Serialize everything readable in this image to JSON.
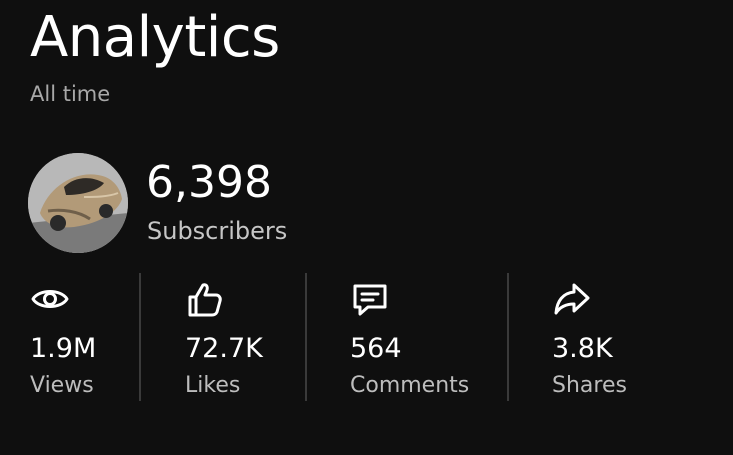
{
  "header": {
    "title": "Analytics",
    "period": "All time"
  },
  "channel": {
    "subscriber_count": "6,398",
    "subscriber_label": "Subscribers",
    "avatar_icon": "channel-avatar"
  },
  "stats": [
    {
      "icon": "eye-icon",
      "value": "1.9M",
      "label": "Views"
    },
    {
      "icon": "thumbs-up-icon",
      "value": "72.7K",
      "label": "Likes"
    },
    {
      "icon": "comment-icon",
      "value": "564",
      "label": "Comments"
    },
    {
      "icon": "share-icon",
      "value": "3.8K",
      "label": "Shares"
    }
  ],
  "colors": {
    "background": "#0f0f0f",
    "text_primary": "#ffffff",
    "text_secondary": "#bdbdbd",
    "divider": "#3a3a3a"
  }
}
